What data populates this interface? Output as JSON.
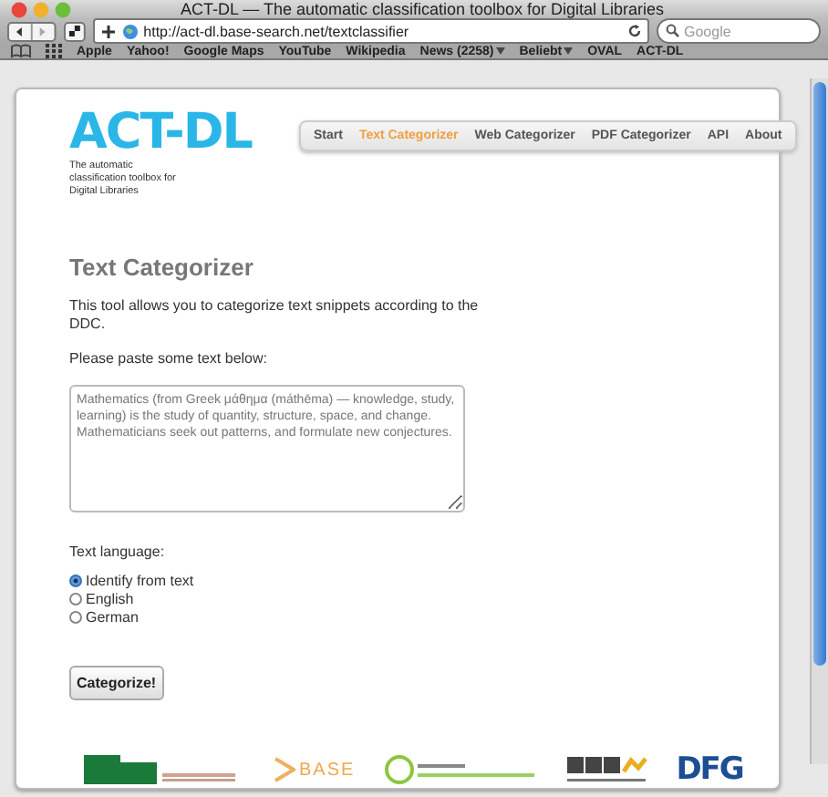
{
  "window": {
    "title": "ACT-DL — The automatic classification toolbox for Digital Libraries"
  },
  "toolbar": {
    "url": "http://act-dl.base-search.net/textclassifier",
    "search_placeholder": "Google"
  },
  "bookmarks": [
    {
      "label": "Apple",
      "menu": false
    },
    {
      "label": "Yahoo!",
      "menu": false
    },
    {
      "label": "Google Maps",
      "menu": false
    },
    {
      "label": "YouTube",
      "menu": false
    },
    {
      "label": "Wikipedia",
      "menu": false
    },
    {
      "label": "News (2258)",
      "menu": true
    },
    {
      "label": "Beliebt",
      "menu": true
    },
    {
      "label": "OVAL",
      "menu": false
    },
    {
      "label": "ACT-DL",
      "menu": false
    }
  ],
  "logo": {
    "title": "ACT-DL",
    "subtitle": "The automatic classification toolbox for Digital Libraries"
  },
  "nav": [
    {
      "label": "Start",
      "selected": false
    },
    {
      "label": "Text Categorizer",
      "selected": true
    },
    {
      "label": "Web Categorizer",
      "selected": false
    },
    {
      "label": "PDF Categorizer",
      "selected": false
    },
    {
      "label": "API",
      "selected": false
    },
    {
      "label": "About",
      "selected": false
    }
  ],
  "heading": "Text Categorizer",
  "intro": "This tool allows you to categorize text snippets according to the DDC.",
  "prompt": "Please paste some text below:",
  "textarea": "Mathematics (from Greek μάθημα (máthēma) — knowledge, study, learning) is the study of quantity, structure, space, and change. Mathematicians seek out patterns, and formulate new conjectures.",
  "language_label": "Text language:",
  "languages": [
    {
      "label": "Identify from text",
      "selected": true
    },
    {
      "label": "English",
      "selected": false
    },
    {
      "label": "German",
      "selected": false
    }
  ],
  "submit": "Categorize!",
  "partners": [
    {
      "kind": "uni"
    },
    {
      "kind": "base",
      "label": "BASE"
    },
    {
      "kind": "hu"
    },
    {
      "kind": "asv"
    },
    {
      "kind": "dfg",
      "label": "DFG"
    }
  ]
}
